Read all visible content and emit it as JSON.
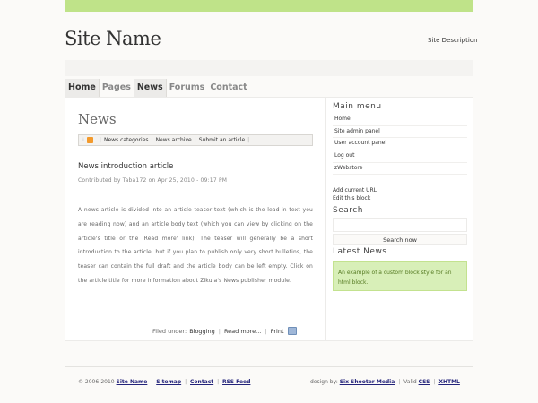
{
  "header": {
    "site_name": "Site Name",
    "site_description": "Site Description"
  },
  "nav": {
    "items": [
      {
        "label": "Home",
        "active": true
      },
      {
        "label": "Pages",
        "active": false
      },
      {
        "label": "News",
        "active": true
      },
      {
        "label": "Forums",
        "active": false
      },
      {
        "label": "Contact",
        "active": false
      }
    ]
  },
  "main": {
    "title": "News",
    "toolbar": {
      "categories": "News categories",
      "archive": "News archive",
      "submit": "Submit an article"
    },
    "article": {
      "title": "News introduction article",
      "byline": "Contributed by Taba172 on Apr 25, 2010 - 09:17 PM",
      "body": "A news article is divided into an article teaser text (which is the lead-in text you are reading now) and an article body text (which you can view by clicking on the article's title or the 'Read more' link). The teaser will generally be a short introduction to the article, but if you plan to publish only very short bulletins, the teaser can contain the full draft and the article body can be left empty. Click on the article title for more information about Zikula's News publisher module.",
      "filed_under_label": "Filed under:",
      "category": "Blogging",
      "read_more": "Read more...",
      "print": "Print"
    }
  },
  "sidebar": {
    "main_menu_title": "Main menu",
    "menu_items": [
      "Home",
      "Site admin panel",
      "User account panel",
      "Log out",
      "zWebstore"
    ],
    "add_url": "Add current URL",
    "edit_block": "Edit this block",
    "search_title": "Search",
    "search_button": "Search now",
    "latest_title": "Latest News",
    "latest_text": "An example of a custom block style for an html block."
  },
  "footer": {
    "copyright": "© 2006-2010",
    "site_name": "Site Name",
    "sitemap": "Sitemap",
    "contact": "Contact",
    "rss": "RSS Feed",
    "design_by": "design by:",
    "designer": "Six Shooter Media",
    "valid": "Valid",
    "css": "CSS",
    "xhtml": "XHTML"
  },
  "colors": {
    "accent_green": "#bfe389",
    "latest_box": "#d8efb8"
  }
}
